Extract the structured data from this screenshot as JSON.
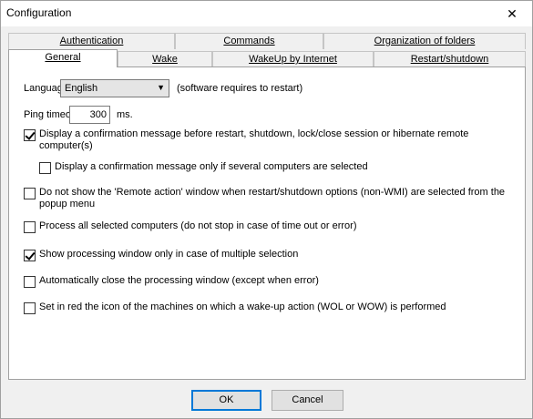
{
  "window": {
    "title": "Configuration"
  },
  "tabs_row1": [
    {
      "label": "Authentication"
    },
    {
      "label": "Commands"
    },
    {
      "label": "Organization of folders"
    }
  ],
  "tabs_row2": [
    {
      "label": "General",
      "active": true
    },
    {
      "label": "Wake"
    },
    {
      "label": "WakeUp by Internet"
    },
    {
      "label": "Restart/shutdown"
    }
  ],
  "general": {
    "language_label": "Language",
    "language_value": "English",
    "language_note": "(software requires to restart)",
    "ping_label": "Ping timeout",
    "ping_value": "300",
    "ping_unit": "ms.",
    "options": [
      {
        "text": "Display a confirmation message before restart, shutdown, lock/close session or hibernate remote computer(s)",
        "checked": true
      },
      {
        "text": "Display a confirmation message only if several computers are selected",
        "checked": false
      },
      {
        "text": "Do not show the 'Remote action' window when restart/shutdown options (non-WMI) are selected from the popup menu",
        "checked": false
      },
      {
        "text": "Process all selected computers (do not stop in case of time out or error)",
        "checked": false
      },
      {
        "text": "Show processing window only in case of multiple selection",
        "checked": true
      },
      {
        "text": "Automatically close the processing window (except when error)",
        "checked": false
      },
      {
        "text": "Set in red the icon of the machines on which a wake-up action (WOL or WOW) is performed",
        "checked": false
      }
    ]
  },
  "footer": {
    "ok_label": "OK",
    "cancel_label": "Cancel"
  }
}
